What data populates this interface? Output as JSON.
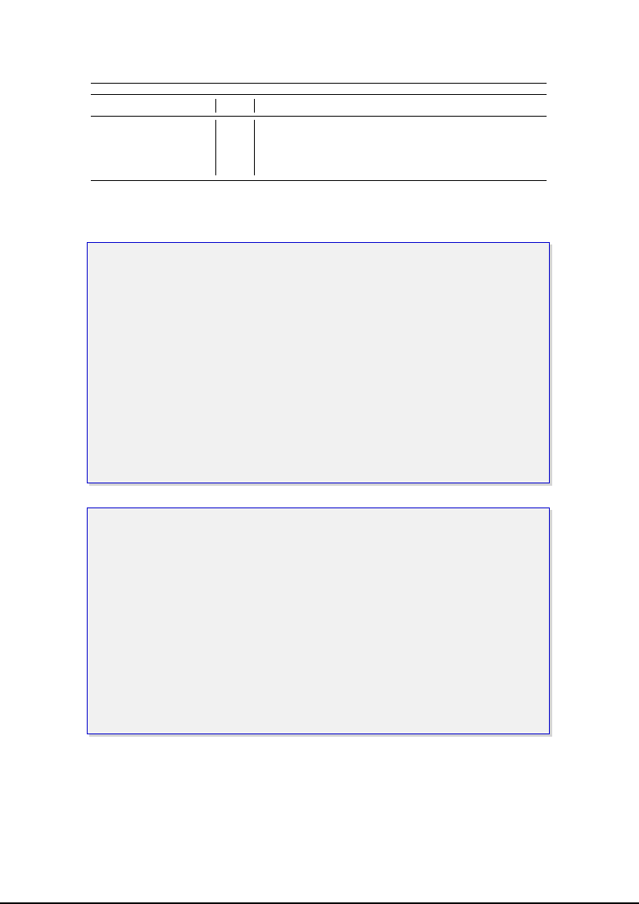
{
  "table": {
    "header": [
      "",
      "",
      ""
    ],
    "rows": [
      [
        "",
        "",
        ""
      ]
    ]
  },
  "listings": {
    "first": "",
    "second": ""
  }
}
